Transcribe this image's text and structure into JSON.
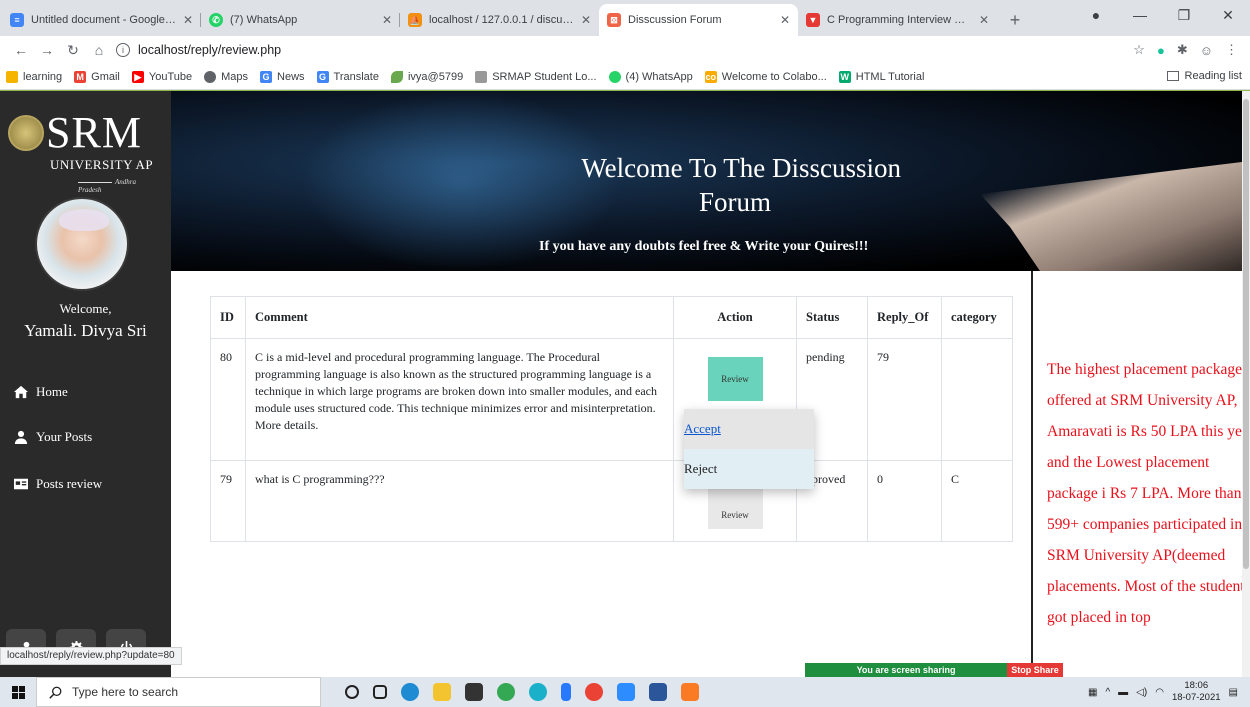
{
  "browser": {
    "tabs": [
      {
        "title": "Untitled document - Google Doc",
        "favicon_color": "#4285f4",
        "active": false
      },
      {
        "title": "(7) WhatsApp",
        "favicon_color": "#25d366",
        "active": false
      },
      {
        "title": "localhost / 127.0.0.1 / discussion",
        "favicon_color": "#f29111",
        "active": false
      },
      {
        "title": "Disscussion Forum",
        "favicon_color": "#f06548",
        "active": true
      },
      {
        "title": "C Programming Interview Questi",
        "favicon_color": "#e53935",
        "active": false
      }
    ],
    "url": "localhost/reply/review.php",
    "reading_list": "Reading list",
    "bookmarks": [
      {
        "label": "learning",
        "color": "#f4b400"
      },
      {
        "label": "Gmail",
        "color": "#ea4335"
      },
      {
        "label": "YouTube",
        "color": "#ff0000"
      },
      {
        "label": "Maps",
        "color": "#5f6368"
      },
      {
        "label": "News",
        "color": "#4285f4"
      },
      {
        "label": "Translate",
        "color": "#4285f4"
      },
      {
        "label": "ivya@5799",
        "color": "#6aa84f"
      },
      {
        "label": "SRMAP Student Lo...",
        "color": "#999999"
      },
      {
        "label": "(4) WhatsApp",
        "color": "#25d366"
      },
      {
        "label": "Welcome to Colabo...",
        "color": "#f9ab00"
      },
      {
        "label": "HTML Tutorial",
        "color": "#04aa6d"
      }
    ]
  },
  "sidebar": {
    "logo_main": "SRM",
    "logo_sub": "UNIVERSITY AP",
    "logo_region": "Andhra Pradesh",
    "welcome": "Welcome,",
    "user_name": "Yamali. Divya Sri",
    "nav": [
      {
        "label": "Home",
        "icon": "home-icon"
      },
      {
        "label": "Your Posts",
        "icon": "user-icon"
      },
      {
        "label": "Posts review",
        "icon": "id-card-icon"
      }
    ]
  },
  "hero": {
    "title_line1": "Welcome To The Disscussion",
    "title_line2": "Forum",
    "subtitle": "If you have any doubts feel free & Write your Quires!!!"
  },
  "table": {
    "headers": [
      "ID",
      "Comment",
      "Action",
      "Status",
      "Reply_Of",
      "category"
    ],
    "rows": [
      {
        "id": "80",
        "comment": "C is a mid-level and procedural programming language. The Procedural programming language is also known as the structured programming language is a technique in which large programs are broken down into smaller modules, and each module uses structured code. This technique minimizes error and misinterpretation. More details.",
        "action": "Review",
        "status": "pending",
        "reply_of": "79",
        "category": ""
      },
      {
        "id": "79",
        "comment": "what is C programming???",
        "action": "Review",
        "status": "pproved",
        "reply_of": "0",
        "category": "C"
      }
    ]
  },
  "dropdown": {
    "accept": "Accept",
    "reject": "Reject"
  },
  "right_panel": {
    "text": "The highest placement package offered at SRM University AP, Amaravati is Rs 50 LPA this year and the Lowest placement package i Rs 7 LPA. More than 599+ companies participated in SRM University AP(deemed placements. Most of the students got placed in top"
  },
  "status_url": "localhost/reply/review.php?update=80",
  "screen_share": {
    "message": "You are screen sharing",
    "stop": "Stop Share"
  },
  "taskbar": {
    "search_placeholder": "Type here to search",
    "time": "18:06",
    "date": "18-07-2021"
  }
}
